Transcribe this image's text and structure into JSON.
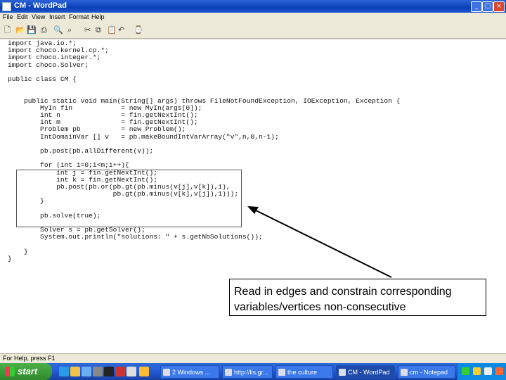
{
  "window": {
    "title": "CM - WordPad",
    "buttons": {
      "minimize": "_",
      "maximize": "□",
      "close": "×"
    }
  },
  "menu": [
    "File",
    "Edit",
    "View",
    "Insert",
    "Format",
    "Help"
  ],
  "toolbar": [
    "new-icon",
    "open-icon",
    "save-icon",
    "print-icon",
    "print-preview-icon",
    "find-icon",
    "cut-icon",
    "copy-icon",
    "paste-icon",
    "undo-icon",
    "date-time-icon"
  ],
  "document": {
    "code_lines": [
      "import java.io.*;",
      "import choco.kernel.cp.*;",
      "import choco.integer.*;",
      "import choco.Solver;",
      "",
      "public class CM {",
      "",
      "",
      "    public static void main(String[] args) throws FileNotFoundException, IOException, Exception {",
      "        MyIn fin            = new MyIn(args[0]);",
      "        int n               = fin.getNextInt();",
      "        int m               = fin.getNextInt();",
      "        Problem pb          = new Problem();",
      "        IntDomainVar [] v   = pb.makeBoundIntVarArray(\"v\",n,0,n-1);",
      "",
      "        pb.post(pb.allDifferent(v));",
      "",
      "        for (int i=0;i<m;i++){",
      "            int j = fin.getNextInt();",
      "            int k = fin.getNextInt();",
      "            pb.post(pb.or(pb.gt(pb.minus(v[j],v[k]),1),",
      "                          pb.gt(pb.minus(v[k],v[j]),1)));",
      "        }",
      "",
      "        pb.solve(true);",
      "",
      "        Solver s = pb.getSolver();",
      "        System.out.println(\"solutions: \" + s.getNbSolutions());",
      "",
      "    }",
      "}"
    ]
  },
  "callout": {
    "text": "Read in edges and constrain corresponding variables/vertices non-consecutive"
  },
  "status": "For Help, press F1",
  "taskbar": {
    "start": "start",
    "tasks": [
      "2 Windows ...",
      "http://lis.gr...",
      "the culture",
      "CM - WordPad",
      "cm - Notepad"
    ]
  },
  "colors": {
    "titlebar": "#0a3fb8",
    "taskbar": "#245edb",
    "start": "#3c9e38",
    "chrome": "#ece9d8"
  }
}
